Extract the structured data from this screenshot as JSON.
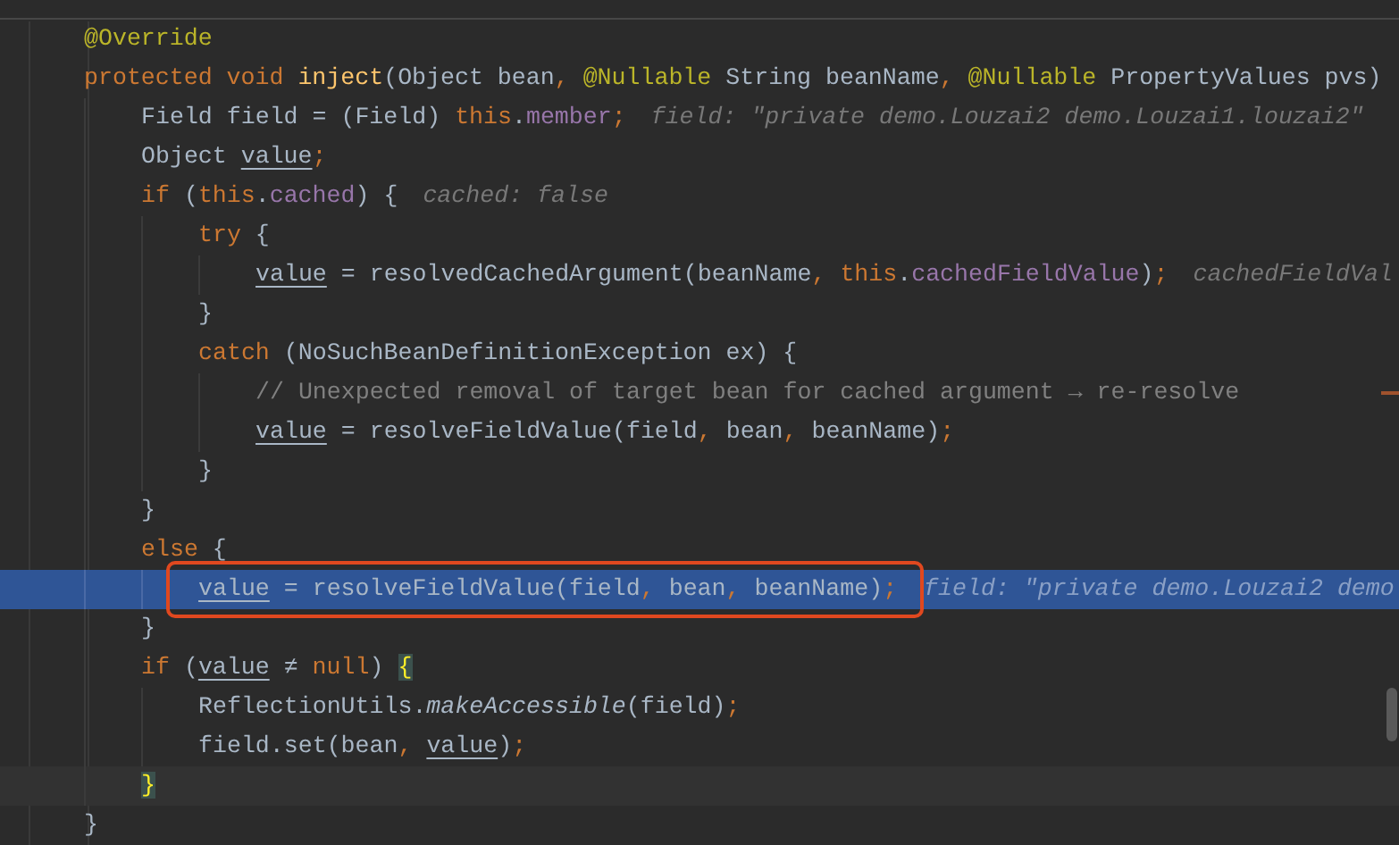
{
  "editor": {
    "lines": [
      {
        "selected": false,
        "caret": false,
        "tokens": [
          {
            "text": "@Override",
            "kind": "annotation"
          }
        ]
      },
      {
        "selected": false,
        "caret": false,
        "tokens": [
          {
            "text": "protected void ",
            "kind": "keyword"
          },
          {
            "text": "inject",
            "kind": "method"
          },
          {
            "text": "(Object bean",
            "kind": "plain"
          },
          {
            "text": ", ",
            "kind": "keyword"
          },
          {
            "text": "@Nullable",
            "kind": "annotation"
          },
          {
            "text": " String beanName",
            "kind": "plain"
          },
          {
            "text": ", ",
            "kind": "keyword"
          },
          {
            "text": "@Nullable",
            "kind": "annotation"
          },
          {
            "text": " PropertyValues pvs)",
            "kind": "plain"
          }
        ],
        "children": [
          {
            "selected": false,
            "caret": false,
            "hint": "field: \"private demo.Louzai2 demo.Louzai1.louzai2\"",
            "tokens": [
              {
                "text": "Field field = (Field) ",
                "kind": "plain"
              },
              {
                "text": "this",
                "kind": "keyword"
              },
              {
                "text": ".",
                "kind": "plain"
              },
              {
                "text": "member",
                "kind": "field"
              },
              {
                "text": ";",
                "kind": "keyword"
              }
            ]
          },
          {
            "selected": false,
            "caret": false,
            "tokens": [
              {
                "text": "Object ",
                "kind": "plain"
              },
              {
                "text": "value",
                "kind": "variable"
              },
              {
                "text": ";",
                "kind": "keyword"
              }
            ]
          },
          {
            "selected": false,
            "caret": false,
            "hint": "cached: false",
            "tokens": [
              {
                "text": "if ",
                "kind": "keyword"
              },
              {
                "text": "(",
                "kind": "plain"
              },
              {
                "text": "this",
                "kind": "keyword"
              },
              {
                "text": ".",
                "kind": "plain"
              },
              {
                "text": "cached",
                "kind": "field"
              },
              {
                "text": ") {",
                "kind": "plain"
              }
            ],
            "children": [
              {
                "selected": false,
                "caret": false,
                "tokens": [
                  {
                    "text": "try",
                    "kind": "keyword"
                  },
                  {
                    "text": " {",
                    "kind": "plain"
                  }
                ],
                "children": [
                  {
                    "selected": false,
                    "caret": false,
                    "hint": "cachedFieldVal",
                    "tokens": [
                      {
                        "text": "value",
                        "kind": "variable"
                      },
                      {
                        "text": " = resolvedCachedArgument(beanName",
                        "kind": "plain"
                      },
                      {
                        "text": ", ",
                        "kind": "keyword"
                      },
                      {
                        "text": "this",
                        "kind": "keyword"
                      },
                      {
                        "text": ".",
                        "kind": "plain"
                      },
                      {
                        "text": "cachedFieldValue",
                        "kind": "field"
                      },
                      {
                        "text": ")",
                        "kind": "plain"
                      },
                      {
                        "text": ";",
                        "kind": "keyword"
                      }
                    ]
                  }
                ]
              },
              {
                "selected": false,
                "caret": false,
                "tokens": [
                  {
                    "text": "}",
                    "kind": "plain"
                  }
                ]
              },
              {
                "selected": false,
                "caret": false,
                "tokens": [
                  {
                    "text": "catch",
                    "kind": "keyword"
                  },
                  {
                    "text": " (NoSuchBeanDefinitionException ex) {",
                    "kind": "plain"
                  }
                ],
                "children": [
                  {
                    "selected": false,
                    "caret": false,
                    "stripe_mark": true,
                    "tokens": [
                      {
                        "text": "// Unexpected removal of target bean for cached argument → re-resolve",
                        "kind": "comment"
                      }
                    ]
                  },
                  {
                    "selected": false,
                    "caret": false,
                    "tokens": [
                      {
                        "text": "value",
                        "kind": "variable"
                      },
                      {
                        "text": " = resolveFieldValue(field",
                        "kind": "plain"
                      },
                      {
                        "text": ", ",
                        "kind": "keyword"
                      },
                      {
                        "text": "bean",
                        "kind": "plain"
                      },
                      {
                        "text": ", ",
                        "kind": "keyword"
                      },
                      {
                        "text": "beanName)",
                        "kind": "plain"
                      },
                      {
                        "text": ";",
                        "kind": "keyword"
                      }
                    ]
                  }
                ]
              },
              {
                "selected": false,
                "caret": false,
                "tokens": [
                  {
                    "text": "}",
                    "kind": "plain"
                  }
                ]
              }
            ]
          },
          {
            "selected": false,
            "caret": false,
            "tokens": [
              {
                "text": "}",
                "kind": "plain"
              }
            ]
          },
          {
            "selected": false,
            "caret": false,
            "tokens": [
              {
                "text": "else",
                "kind": "keyword"
              },
              {
                "text": " {",
                "kind": "plain"
              }
            ],
            "children": [
              {
                "selected": true,
                "caret": false,
                "outlined": true,
                "hint": "field: \"private demo.Louzai2 demo",
                "tokens": [
                  {
                    "text": "value",
                    "kind": "variable"
                  },
                  {
                    "text": " = resolveFieldValue(field",
                    "kind": "plain"
                  },
                  {
                    "text": ", ",
                    "kind": "keyword"
                  },
                  {
                    "text": "bean",
                    "kind": "plain"
                  },
                  {
                    "text": ", ",
                    "kind": "keyword"
                  },
                  {
                    "text": "beanName)",
                    "kind": "plain"
                  },
                  {
                    "text": ";",
                    "kind": "keyword"
                  }
                ]
              }
            ]
          },
          {
            "selected": false,
            "caret": false,
            "tokens": [
              {
                "text": "}",
                "kind": "plain"
              }
            ]
          },
          {
            "selected": false,
            "caret": false,
            "tokens": [
              {
                "text": "if ",
                "kind": "keyword"
              },
              {
                "text": "(",
                "kind": "plain"
              },
              {
                "text": "value",
                "kind": "variable"
              },
              {
                "text": " ≠ ",
                "kind": "plain"
              },
              {
                "text": "null",
                "kind": "keyword"
              },
              {
                "text": ") ",
                "kind": "plain"
              },
              {
                "text": "{",
                "kind": "brace_match"
              }
            ],
            "children": [
              {
                "selected": false,
                "caret": false,
                "tokens": [
                  {
                    "text": "ReflectionUtils.",
                    "kind": "plain"
                  },
                  {
                    "text": "makeAccessible",
                    "kind": "static"
                  },
                  {
                    "text": "(field)",
                    "kind": "plain"
                  },
                  {
                    "text": ";",
                    "kind": "keyword"
                  }
                ]
              },
              {
                "selected": false,
                "caret": false,
                "tokens": [
                  {
                    "text": "field.set(bean",
                    "kind": "plain"
                  },
                  {
                    "text": ", ",
                    "kind": "keyword"
                  },
                  {
                    "text": "value",
                    "kind": "variable"
                  },
                  {
                    "text": ")",
                    "kind": "plain"
                  },
                  {
                    "text": ";",
                    "kind": "keyword"
                  }
                ]
              }
            ]
          },
          {
            "selected": false,
            "caret": true,
            "tokens": [
              {
                "text": "}",
                "kind": "brace_match"
              }
            ]
          }
        ]
      },
      {
        "selected": false,
        "caret": false,
        "tokens": [
          {
            "text": "}",
            "kind": "plain"
          }
        ]
      }
    ]
  }
}
